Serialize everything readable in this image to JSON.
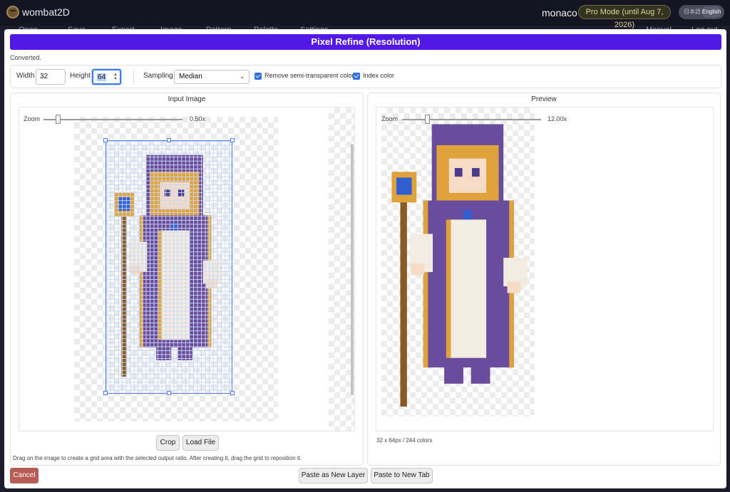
{
  "app": {
    "name": "wombat2D",
    "user": "monaco",
    "pro_badge": "Pro Mode (until Aug 7, 2026)",
    "lang_ja": "日本語",
    "lang_en": "English"
  },
  "menu": [
    "Open",
    "Save",
    "Export",
    "Image",
    "Pattern",
    "Palette",
    "Settings",
    "Manual",
    "Log out"
  ],
  "dialog": {
    "title": "Pixel Refine (Resolution)",
    "status": "Converted.",
    "width_label": "Width",
    "width_value": "32",
    "height_label": "Height",
    "height_value": "64",
    "sampling_label": "Sampling",
    "sampling_value": "Median",
    "remove_semi_label": "Remove semi-transparent colors",
    "remove_semi_checked": true,
    "index_color_label": "Index color",
    "index_color_checked": true,
    "input_panel_title": "Input Image",
    "preview_panel_title": "Preview",
    "zoom_label": "Zoom",
    "input_zoom": "0.50x",
    "input_zoom_level": 0.1,
    "preview_zoom": "12.00x",
    "preview_zoom_level": 0.18,
    "crop_label": "Crop",
    "load_file_label": "Load File",
    "hint": "Drag on the image to create a grid area with the selected output ratio. After creating it, drag the grid to reposition it.",
    "preview_meta": "32 x 64px / 244 colors",
    "cancel_label": "Cancel",
    "paste_layer_label": "Paste as New Layer",
    "paste_tab_label": "Paste to New Tab"
  },
  "colors": {
    "accent": "#5218e6",
    "cancel": "#b85a55",
    "grid": "#4d7ef0",
    "robe": "#6a4c9c",
    "hair": "#e0a33c",
    "dress": "#f3ece0",
    "gem": "#2f5fd0"
  }
}
